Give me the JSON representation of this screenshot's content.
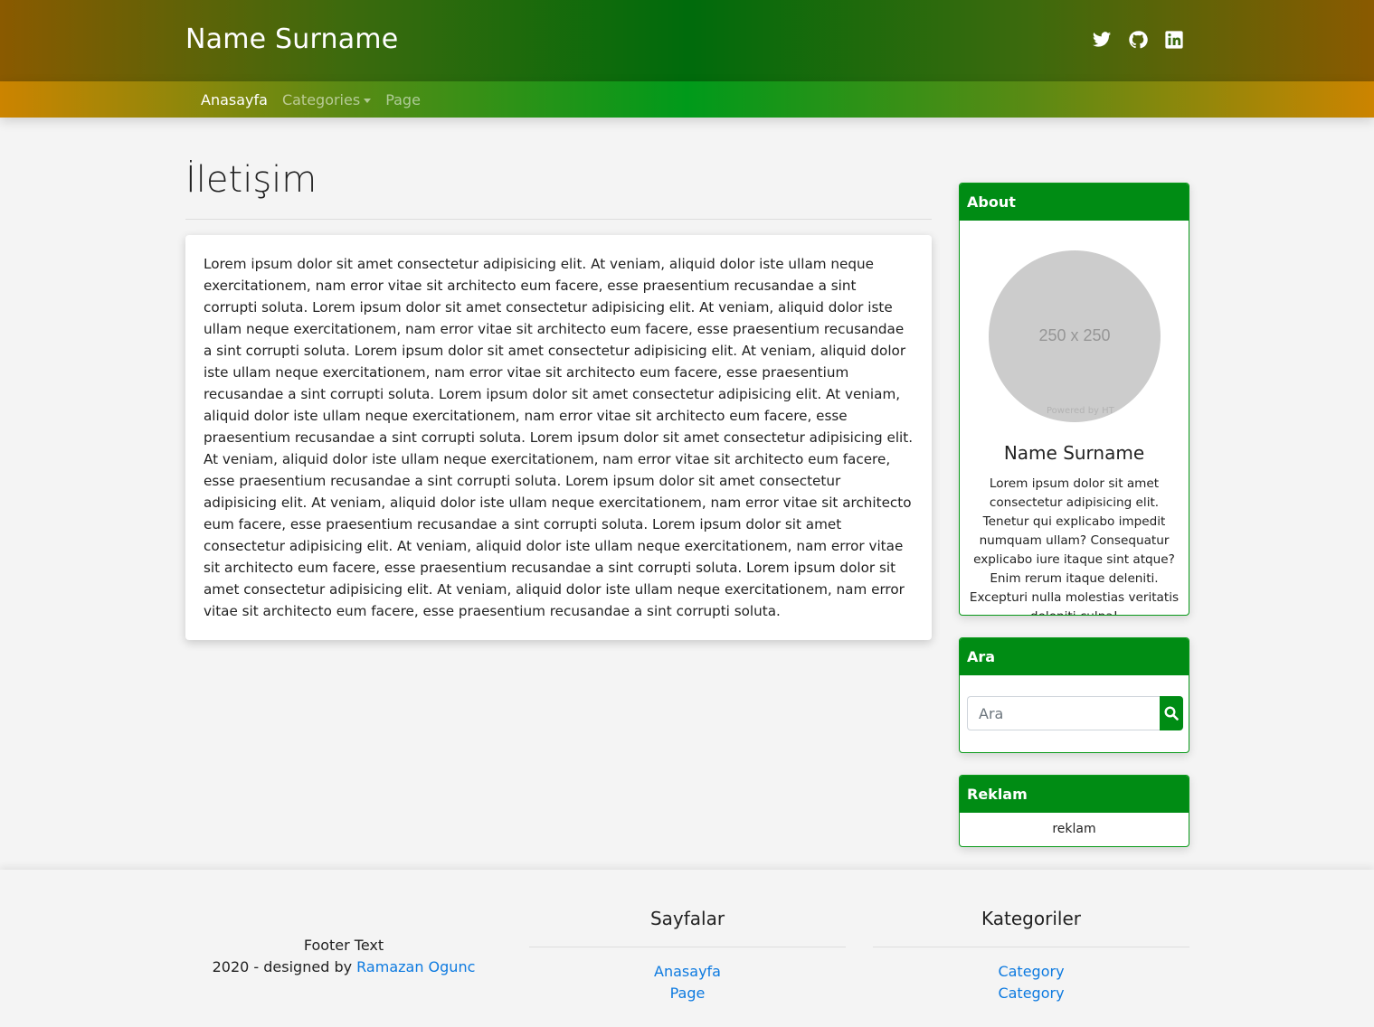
{
  "header": {
    "brand": "Name Surname",
    "social": [
      {
        "icon": "twitter-icon"
      },
      {
        "icon": "github-icon"
      },
      {
        "icon": "linkedin-icon"
      }
    ]
  },
  "nav": {
    "items": [
      {
        "label": "Anasayfa",
        "active": true
      },
      {
        "label": "Categories",
        "dropdown": true
      },
      {
        "label": "Page"
      }
    ]
  },
  "main": {
    "title": "İletişim",
    "body": "Lorem ipsum dolor sit amet consectetur adipisicing elit. At veniam, aliquid dolor iste ullam neque exercitationem, nam error vitae sit architecto eum facere, esse praesentium recusandae a sint corrupti soluta. Lorem ipsum dolor sit amet consectetur adipisicing elit. At veniam, aliquid dolor iste ullam neque exercitationem, nam error vitae sit architecto eum facere, esse praesentium recusandae a sint corrupti soluta. Lorem ipsum dolor sit amet consectetur adipisicing elit. At veniam, aliquid dolor iste ullam neque exercitationem, nam error vitae sit architecto eum facere, esse praesentium recusandae a sint corrupti soluta. Lorem ipsum dolor sit amet consectetur adipisicing elit. At veniam, aliquid dolor iste ullam neque exercitationem, nam error vitae sit architecto eum facere, esse praesentium recusandae a sint corrupti soluta. Lorem ipsum dolor sit amet consectetur adipisicing elit. At veniam, aliquid dolor iste ullam neque exercitationem, nam error vitae sit architecto eum facere, esse praesentium recusandae a sint corrupti soluta. Lorem ipsum dolor sit amet consectetur adipisicing elit. At veniam, aliquid dolor iste ullam neque exercitationem, nam error vitae sit architecto eum facere, esse praesentium recusandae a sint corrupti soluta. Lorem ipsum dolor sit amet consectetur adipisicing elit. At veniam, aliquid dolor iste ullam neque exercitationem, nam error vitae sit architecto eum facere, esse praesentium recusandae a sint corrupti soluta. Lorem ipsum dolor sit amet consectetur adipisicing elit. At veniam, aliquid dolor iste ullam neque exercitationem, nam error vitae sit architecto eum facere, esse praesentium recusandae a sint corrupti soluta."
  },
  "sidebar": {
    "about": {
      "heading": "About",
      "avatar_placeholder": "250 x 250",
      "avatar_watermark": "Powered by HT",
      "name": "Name Surname",
      "text": "Lorem ipsum dolor sit amet consectetur adipisicing elit. Tenetur qui explicabo impedit numquam ullam? Consequatur explicabo iure itaque sint atque? Enim rerum itaque deleniti. Excepturi nulla molestias veritatis deleniti culpa!"
    },
    "search": {
      "heading": "Ara",
      "placeholder": "Ara"
    },
    "ad": {
      "heading": "Reklam",
      "text": "reklam"
    }
  },
  "footer": {
    "text": "Footer Text",
    "credit_prefix": "2020 - designed by ",
    "credit_link": "Ramazan Ogunc",
    "pages": {
      "heading": "Sayfalar",
      "links": [
        "Anasayfa",
        "Page"
      ]
    },
    "categories": {
      "heading": "Kategoriler",
      "links": [
        "Category",
        "Category"
      ]
    }
  },
  "colors": {
    "accent_green": "#008c14",
    "link_blue": "#0d7ae0",
    "background": "#f4f4f4"
  }
}
